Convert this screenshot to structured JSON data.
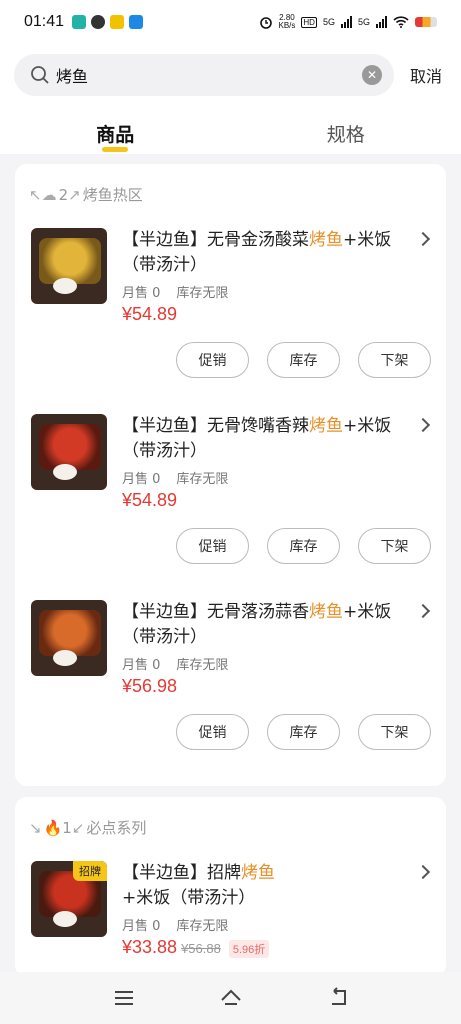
{
  "status_bar": {
    "time": "01:41",
    "net_speed": "2.80",
    "net_unit": "KB/s",
    "hd": "HD",
    "sim1": "5G",
    "sim2": "5G"
  },
  "search": {
    "value": "烤鱼",
    "placeholder": "",
    "cancel_label": "取消"
  },
  "tabs": [
    {
      "label": "商品",
      "active": true
    },
    {
      "label": "规格",
      "active": false
    }
  ],
  "sections": [
    {
      "title": "烤鱼热区",
      "count": "2",
      "products": [
        {
          "name_prefix": "【半边鱼】无骨金汤酸菜",
          "name_highlight": "烤鱼",
          "name_suffix": "+米饭（带汤汁）",
          "monthly_sales": "月售 0",
          "stock": "库存无限",
          "price": "¥54.89",
          "actions": [
            "促销",
            "库存",
            "下架"
          ]
        },
        {
          "name_prefix": "【半边鱼】无骨馋嘴香辣",
          "name_highlight": "烤鱼",
          "name_suffix": "+米饭（带汤汁）",
          "monthly_sales": "月售 0",
          "stock": "库存无限",
          "price": "¥54.89",
          "actions": [
            "促销",
            "库存",
            "下架"
          ]
        },
        {
          "name_prefix": "【半边鱼】无骨落汤蒜香",
          "name_highlight": "烤鱼",
          "name_suffix": "+米饭（带汤汁）",
          "monthly_sales": "月售 0",
          "stock": "库存无限",
          "price": "¥56.98",
          "actions": [
            "促销",
            "库存",
            "下架"
          ]
        }
      ]
    },
    {
      "title": "必点系列",
      "count": "1",
      "products": [
        {
          "tag": "招牌",
          "name_prefix": "【半边鱼】招牌",
          "name_highlight": "烤鱼",
          "name_suffix": "+米饭（带汤汁）",
          "monthly_sales": "月售 0",
          "stock": "库存无限",
          "price": "¥33.88",
          "original_price": "¥56.88",
          "discount": "5.96折"
        }
      ]
    }
  ],
  "colors": {
    "accent": "#f5c518",
    "highlight": "#e8902a",
    "price": "#e53935"
  }
}
